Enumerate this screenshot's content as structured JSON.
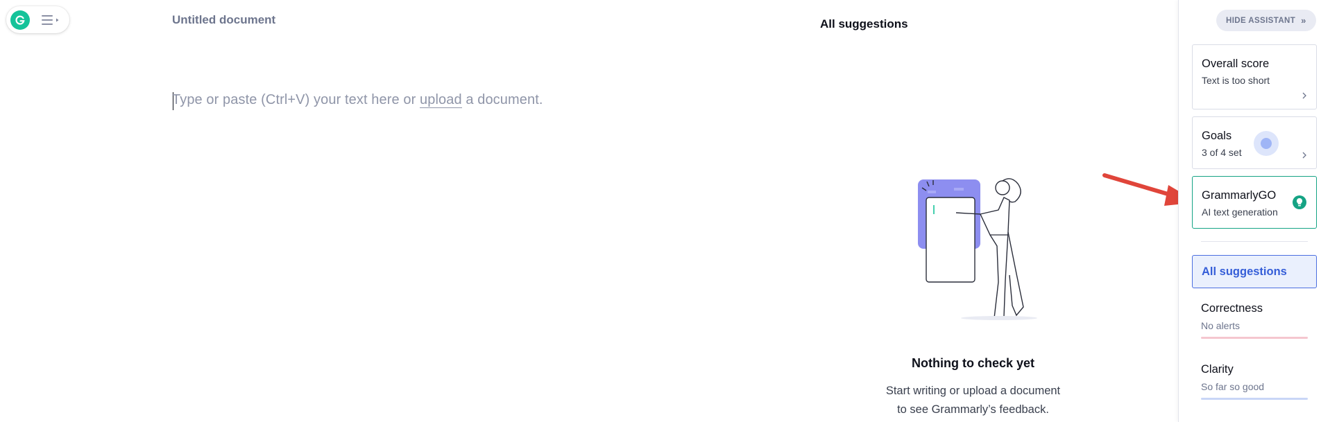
{
  "document": {
    "title": "Untitled document",
    "placeholder_before": "Type or paste (Ctrl+V) your text here or ",
    "placeholder_link": "upload",
    "placeholder_after": " a document."
  },
  "suggestions_panel": {
    "heading": "All suggestions",
    "empty_title": "Nothing to check yet",
    "empty_line1": "Start writing or upload a document",
    "empty_line2": "to see Grammarly’s feedback."
  },
  "sidebar": {
    "hide_button_label": "HIDE ASSISTANT",
    "hide_button_icon": "»",
    "overall_score": {
      "title": "Overall score",
      "subtitle": "Text is too short"
    },
    "goals": {
      "title": "Goals",
      "subtitle": "3 of 4 set"
    },
    "grammarly_go": {
      "title": "GrammarlyGO",
      "subtitle": "AI text generation"
    },
    "all_suggestions_tab": "All suggestions",
    "categories": [
      {
        "title": "Correctness",
        "subtitle": "No alerts",
        "color": "#f5c6cf"
      },
      {
        "title": "Clarity",
        "subtitle": "So far so good",
        "color": "#c9d6f7"
      }
    ]
  },
  "colors": {
    "brand_green": "#15c39a",
    "accent_blue": "#4a6ee0",
    "annotation_arrow": "#e0453a"
  },
  "icons": [
    "grammarly-logo-icon",
    "menu-icon",
    "chevron-right-icon",
    "lightbulb-icon",
    "annotation-arrow"
  ]
}
